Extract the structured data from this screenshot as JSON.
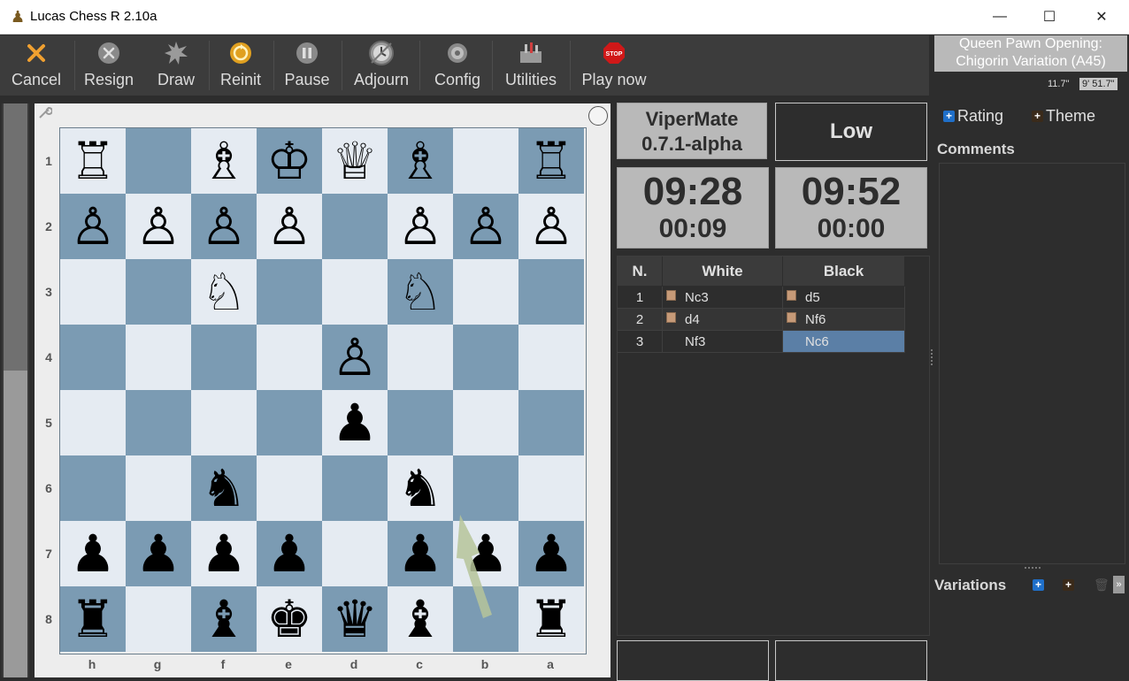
{
  "window": {
    "title": "Lucas Chess R 2.10a",
    "minimize": "—",
    "maximize": "☐",
    "close": "✕"
  },
  "toolbar": {
    "cancel": "Cancel",
    "resign": "Resign",
    "draw": "Draw",
    "reinit": "Reinit",
    "pause": "Pause",
    "adjourn": "Adjourn",
    "config": "Config",
    "utilities": "Utilities",
    "play_now": "Play now",
    "stop_text": "STOP"
  },
  "opening": {
    "line1": "Queen Pawn Opening:",
    "line2": "Chigorin Variation (A45)"
  },
  "times": {
    "left": "11.7\"",
    "right": "9' 51.7\""
  },
  "engine": {
    "name": "ViperMate",
    "version": "0.7.1-alpha"
  },
  "level": "Low",
  "clocks": {
    "left": {
      "main": "09:28",
      "move": "00:09"
    },
    "right": {
      "main": "09:52",
      "move": "00:00"
    }
  },
  "board": {
    "ranks": [
      "1",
      "2",
      "3",
      "4",
      "5",
      "6",
      "7",
      "8"
    ],
    "files": [
      "h",
      "g",
      "f",
      "e",
      "d",
      "c",
      "b",
      "a"
    ],
    "rows": [
      [
        "♖",
        "",
        "♗",
        "♔",
        "♕",
        "♗",
        "",
        "♖"
      ],
      [
        "♙",
        "♙",
        "♙",
        "♙",
        "",
        "♙",
        "♙",
        "♙"
      ],
      [
        "",
        "",
        "♘",
        "",
        "",
        "♘",
        "",
        ""
      ],
      [
        "",
        "",
        "",
        "",
        "♙",
        "",
        "",
        ""
      ],
      [
        "",
        "",
        "",
        "",
        "♟",
        "",
        "",
        ""
      ],
      [
        "",
        "",
        "♞",
        "",
        "",
        "♞",
        "",
        ""
      ],
      [
        "♟",
        "♟",
        "♟",
        "♟",
        "",
        "♟",
        "♟",
        "♟"
      ],
      [
        "♜",
        "",
        "♝",
        "♚",
        "♛",
        "♝",
        "",
        "♜"
      ]
    ]
  },
  "moves": {
    "headers": {
      "n": "N.",
      "white": "White",
      "black": "Black"
    },
    "rows": [
      {
        "n": "1",
        "white": "Nc3",
        "black": "d5"
      },
      {
        "n": "2",
        "white": "d4",
        "black": "Nf6"
      },
      {
        "n": "3",
        "white": "Nf3",
        "black": "Nc6"
      }
    ]
  },
  "right_panel": {
    "rating": "Rating",
    "theme": "Theme",
    "comments": "Comments",
    "variations": "Variations",
    "collapse": "»"
  },
  "colors": {
    "light_square": "#e5ebf2",
    "dark_square": "#7b9bb3",
    "selected_move": "#5b7fa6",
    "arrow": "#b6c49a"
  }
}
